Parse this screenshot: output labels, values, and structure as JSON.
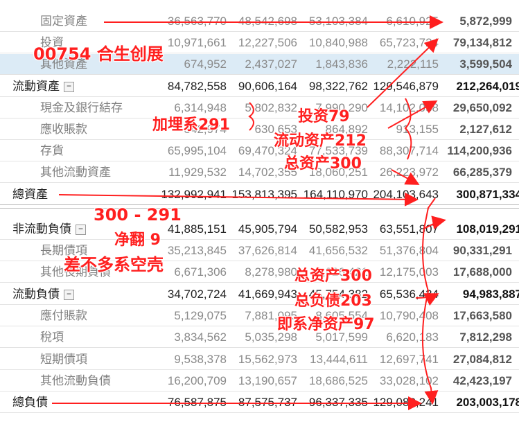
{
  "rows": [
    {
      "label": "固定資產",
      "v1": "36,563,770",
      "v2": "48,542,698",
      "v3": "53,103,384",
      "v4": "6,610,925",
      "v5": "5,872,999"
    },
    {
      "label": "投資",
      "v1": "10,971,661",
      "v2": "12,227,506",
      "v3": "10,840,988",
      "v4": "65,723,724",
      "v5": "79,134,812"
    },
    {
      "label": "其他資產",
      "v1": "674,952",
      "v2": "2,437,027",
      "v3": "1,843,836",
      "v4": "2,222,115",
      "v5": "3,599,504"
    },
    {
      "label": "流動資產",
      "v1": "84,782,558",
      "v2": "90,606,164",
      "v3": "98,322,762",
      "v4": "129,546,879",
      "v5": "212,264,019"
    },
    {
      "label": "現金及銀行結存",
      "v1": "6,314,948",
      "v2": "5,802,832",
      "v3": "7,990,290",
      "v4": "14,102,038",
      "v5": "29,650,092"
    },
    {
      "label": "應收賬款",
      "v1": "542,974",
      "v2": "630,653",
      "v3": "864,892",
      "v4": "913,155",
      "v5": "2,127,612"
    },
    {
      "label": "存貨",
      "v1": "65,995,104",
      "v2": "69,470,324",
      "v3": "77,533,739",
      "v4": "88,307,714",
      "v5": "114,200,936"
    },
    {
      "label": "其他流動資產",
      "v1": "11,929,532",
      "v2": "14,702,355",
      "v3": "18,060,251",
      "v4": "26,223,972",
      "v5": "66,285,379"
    },
    {
      "label": "總資產",
      "v1": "132,992,941",
      "v2": "153,813,395",
      "v3": "164,110,970",
      "v4": "204,103,643",
      "v5": "300,871,334"
    },
    {
      "label": "非流動負債",
      "v1": "41,885,151",
      "v2": "45,905,794",
      "v3": "50,582,953",
      "v4": "63,551,807",
      "v5": "108,019,291"
    },
    {
      "label": "長期債項",
      "v1": "35,213,845",
      "v2": "37,626,814",
      "v3": "41,656,532",
      "v4": "51,376,804",
      "v5": "90,331,291"
    },
    {
      "label": "其他長期負債",
      "v1": "6,671,306",
      "v2": "8,278,980",
      "v3": "8,926,421",
      "v4": "12,175,003",
      "v5": "17,688,000"
    },
    {
      "label": "流動負債",
      "v1": "34,702,724",
      "v2": "41,669,943",
      "v3": "45,754,382",
      "v4": "65,536,434",
      "v5": "94,983,887"
    },
    {
      "label": "應付賬款",
      "v1": "5,129,075",
      "v2": "7,881,095",
      "v3": "8,605,554",
      "v4": "10,790,408",
      "v5": "17,663,580"
    },
    {
      "label": "稅項",
      "v1": "3,834,562",
      "v2": "5,035,298",
      "v3": "5,017,599",
      "v4": "6,620,183",
      "v5": "7,812,298"
    },
    {
      "label": "短期債項",
      "v1": "9,538,378",
      "v2": "15,562,973",
      "v3": "13,444,611",
      "v4": "12,697,741",
      "v5": "27,084,812"
    },
    {
      "label": "其他流動負債",
      "v1": "16,200,709",
      "v2": "13,190,657",
      "v3": "18,686,525",
      "v4": "33,028,102",
      "v5": "42,423,197"
    },
    {
      "label": "總負債",
      "v1": "76,587,875",
      "v2": "87,575,737",
      "v3": "96,337,335",
      "v4": "129,088,241",
      "v5": "203,003,178"
    }
  ],
  "toggle_symbol": "−",
  "annotations": {
    "company": "00754 合生创展",
    "reinvest": "加埋系291",
    "invest": "投资79",
    "current_assets": "流动资产212",
    "total_assets": "总资产300",
    "formula": "300 - 291",
    "net_cash": "净翻 9",
    "shell": "差不多系空壳",
    "total_assets2": "总资产300",
    "total_liab": "总负债203",
    "net_assets": "即系净资产97"
  },
  "colors": {
    "annotation": "#ff1f1f",
    "selected_row": "#dcebf6"
  }
}
